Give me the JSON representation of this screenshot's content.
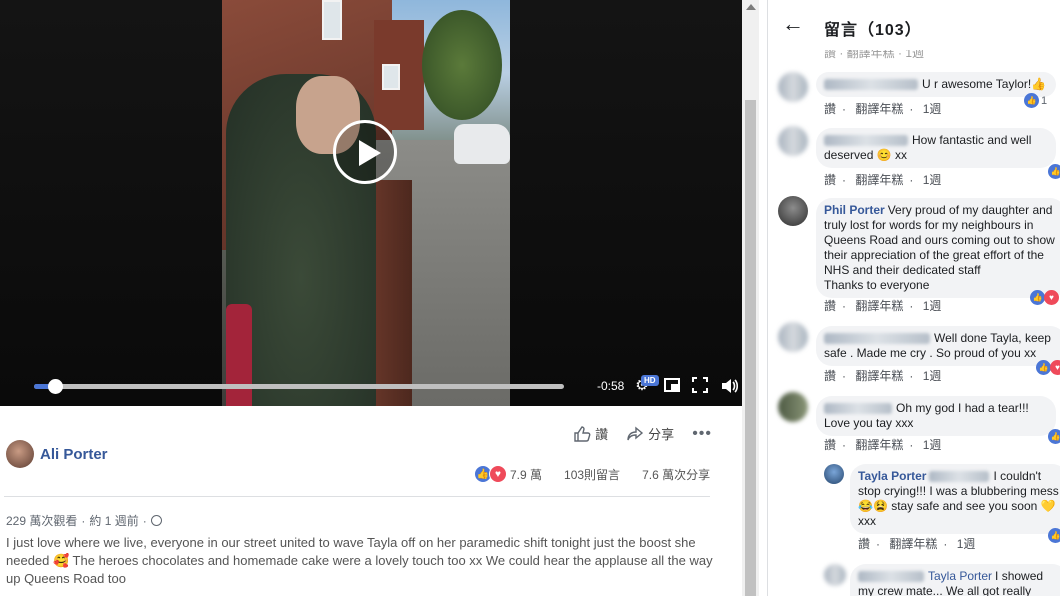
{
  "video": {
    "time_remaining": "-0:58",
    "hd_badge": "HD",
    "progress": 0.04
  },
  "post": {
    "actions": {
      "like": "讚",
      "share": "分享"
    },
    "author": "Ali Porter",
    "reactions_count": "7.9 萬",
    "comments_count": "103則留言",
    "shares_count": "7.6 萬次分享",
    "views": "229 萬次觀看",
    "time": "約 1 週前",
    "description": "I just love where we live, everyone in our street united to wave Tayla off on her paramedic shift tonight just the boost she needed 🥰 The heroes chocolates and homemade cake were a lovely touch too xx We could hear the applause all the way up Queens Road too"
  },
  "comments_panel": {
    "title": "留言（103）",
    "top_partial_actions": "讚 · 翻譯年糕 · 1週",
    "comments": [
      {
        "name": "",
        "text": "U r awesome Taylor!👍",
        "like": "讚",
        "translate": "翻譯年糕",
        "time": "1週",
        "reaction_count": "1"
      },
      {
        "name": "",
        "text": "How fantastic and well deserved 😊 xx",
        "like": "讚",
        "translate": "翻譯年糕",
        "time": "1週",
        "reaction_count": ""
      },
      {
        "name": "Phil Porter",
        "text": "Very proud of my daughter and truly lost for words for my neighbours in Queens Road and ours coming out to show their appreciation of the great effort of the NHS and their dedicated staff\nThanks to everyone",
        "like": "讚",
        "translate": "翻譯年糕",
        "time": "1週",
        "reaction_count": ""
      },
      {
        "name": "",
        "text": "Well done Tayla, keep safe . Made me cry . So proud of you xx",
        "like": "讚",
        "translate": "翻譯年糕",
        "time": "1週",
        "reaction_count": ""
      },
      {
        "name": "",
        "text": "Oh my god I had a tear!!! Love you tay xxx",
        "like": "讚",
        "translate": "翻譯年糕",
        "time": "1週",
        "reaction_count": ""
      },
      {
        "name": "Tayla Porter",
        "text": "I couldn't stop crying!!! I was a blubbering mess 😂😫 stay safe and see you soon 💛xxx",
        "like": "讚",
        "translate": "翻譯年糕",
        "time": "1週",
        "reaction_count": ""
      },
      {
        "name": "Tayla Porter",
        "text": "I showed my crew mate... We all got really emotional",
        "like": "",
        "translate": "",
        "time": "",
        "reaction_count": ""
      }
    ]
  },
  "colors": {
    "accent": "#4b76d6",
    "link": "#365899",
    "love": "#ef4a5a"
  },
  "icons": [
    "play-icon",
    "settings-icon",
    "pip-icon",
    "fullscreen-icon",
    "volume-icon",
    "like-icon",
    "share-icon",
    "more-icon",
    "globe-icon",
    "back-arrow-icon"
  ]
}
